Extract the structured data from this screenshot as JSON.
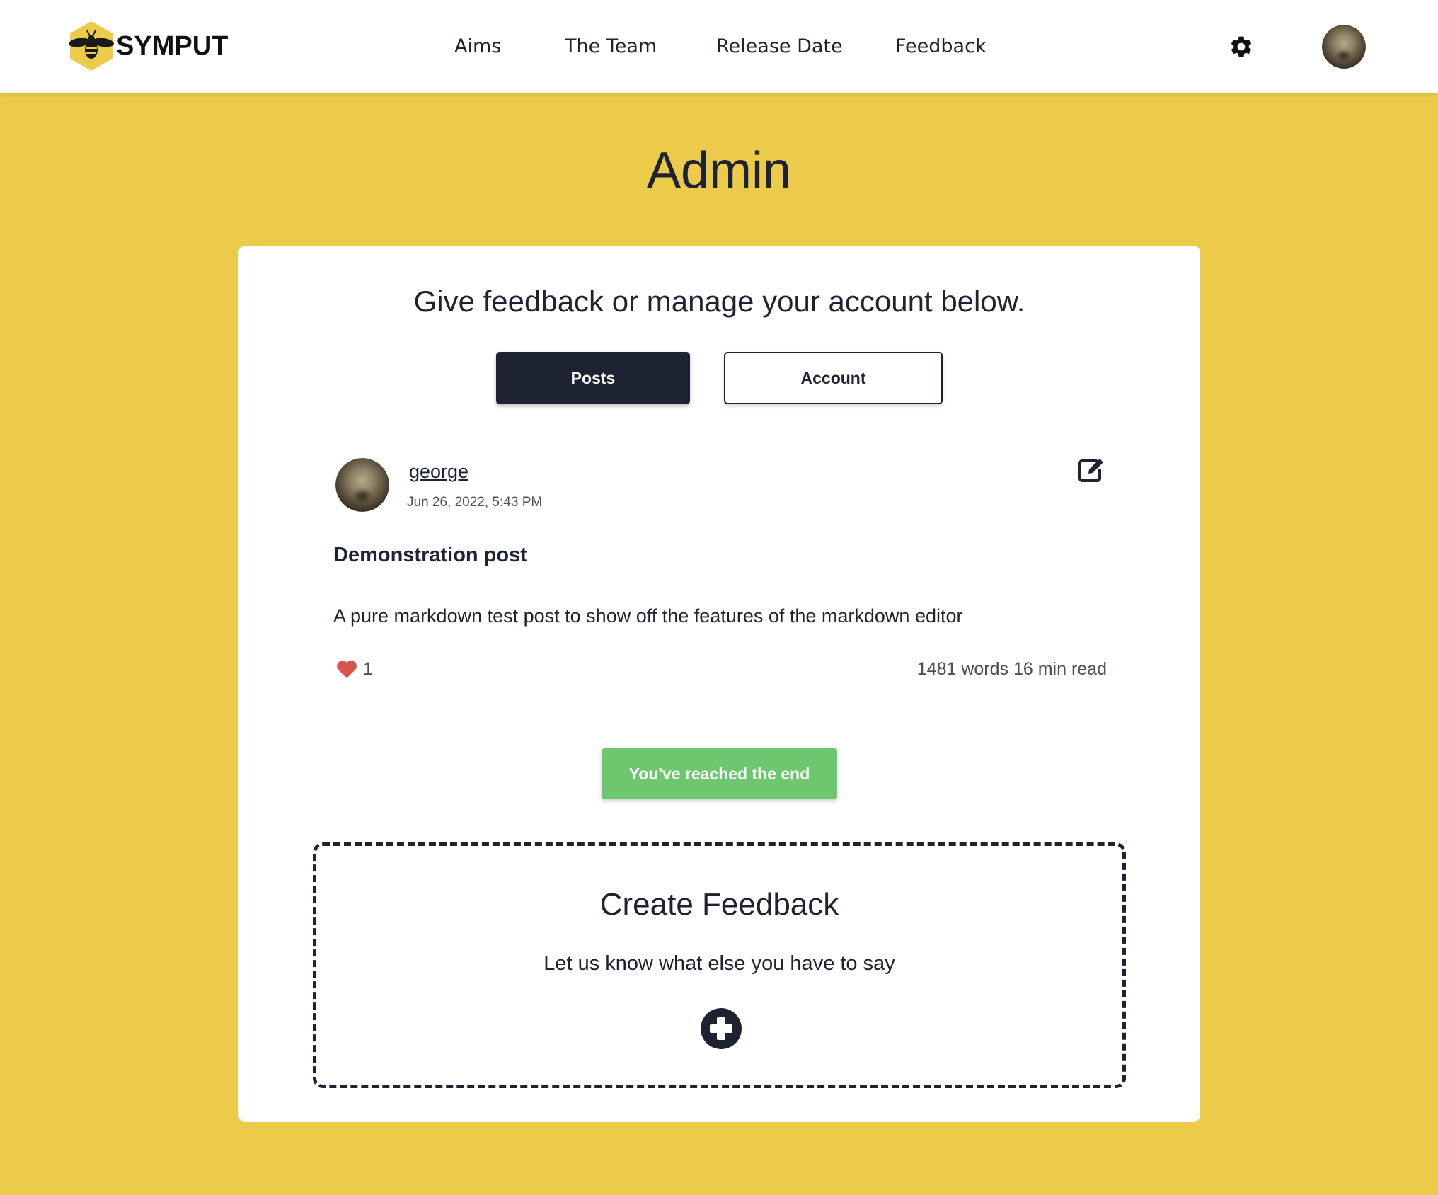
{
  "header": {
    "brand_name": "SYMPUT",
    "nav": [
      "Aims",
      "The Team",
      "Release Date",
      "Feedback"
    ],
    "settings_icon": "gear-icon",
    "avatar_icon": "user-avatar"
  },
  "page": {
    "title": "Admin"
  },
  "card": {
    "heading": "Give feedback or manage your account below.",
    "tabs": [
      {
        "label": "Posts",
        "active": true
      },
      {
        "label": "Account",
        "active": false
      }
    ]
  },
  "post": {
    "author": "george",
    "date": "Jun 26, 2022, 5:43 PM",
    "title": "Demonstration post",
    "excerpt": "A pure markdown test post to show off the features of the markdown editor",
    "likes": "1",
    "stats": "1481 words 16 min read",
    "edit_icon": "edit-icon",
    "like_icon": "heart-icon"
  },
  "end_banner": "You've reached the end",
  "create": {
    "title": "Create Feedback",
    "subtitle": "Let us know what else you have to say",
    "add_icon": "plus-circle-icon"
  },
  "colors": {
    "background": "#eccb4b",
    "primary_dark": "#1d2331",
    "success": "#6ec76e",
    "heart": "#d9534f"
  }
}
